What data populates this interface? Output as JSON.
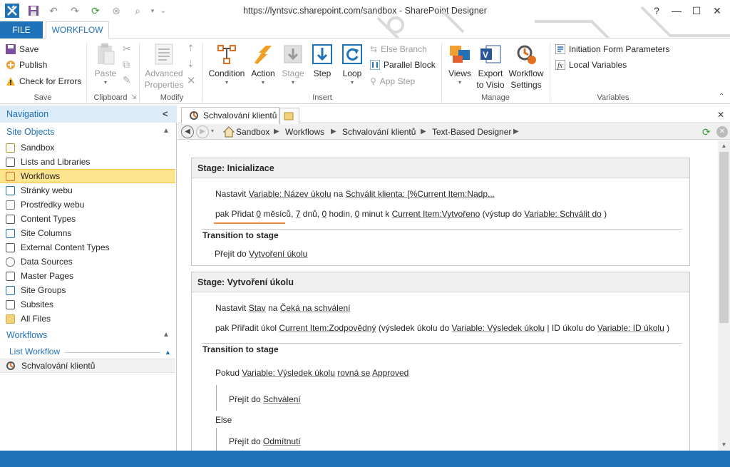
{
  "window": {
    "title": "https://lyntsvc.sharepoint.com/sandbox - SharePoint Designer",
    "help": "?",
    "minimize": "—",
    "maximize": "☐",
    "close": "✕"
  },
  "tabs": {
    "file": "FILE",
    "workflow": "WORKFLOW"
  },
  "ribbon": {
    "save": {
      "save": "Save",
      "publish": "Publish",
      "check": "Check for Errors",
      "label": "Save"
    },
    "clipboard": {
      "paste": "Paste",
      "label": "Clipboard"
    },
    "modify": {
      "adv1": "Advanced",
      "adv2": "Properties",
      "label": "Modify"
    },
    "insert": {
      "condition": "Condition",
      "action": "Action",
      "stage": "Stage",
      "step": "Step",
      "loop": "Loop",
      "else_branch": "Else Branch",
      "parallel_block": "Parallel Block",
      "app_step": "App Step",
      "label": "Insert"
    },
    "manage": {
      "views": "Views",
      "export1": "Export",
      "export2": "to Visio",
      "wfs1": "Workflow",
      "wfs2": "Settings",
      "label": "Manage"
    },
    "variables": {
      "init": "Initiation Form Parameters",
      "local": "Local Variables",
      "label": "Variables"
    }
  },
  "nav": {
    "header": "Navigation",
    "collapse": "<",
    "site_objects": "Site Objects",
    "items": [
      {
        "label": "Sandbox",
        "icon": "home-icon"
      },
      {
        "label": "Lists and Libraries",
        "icon": "list-icon"
      },
      {
        "label": "Workflows",
        "icon": "workflow-icon"
      },
      {
        "label": "Stránky webu",
        "icon": "pages-icon"
      },
      {
        "label": "Prostředky webu",
        "icon": "assets-icon"
      },
      {
        "label": "Content Types",
        "icon": "content-types-icon"
      },
      {
        "label": "Site Columns",
        "icon": "columns-icon"
      },
      {
        "label": "External Content Types",
        "icon": "external-icon"
      },
      {
        "label": "Data Sources",
        "icon": "database-icon"
      },
      {
        "label": "Master Pages",
        "icon": "master-icon"
      },
      {
        "label": "Site Groups",
        "icon": "groups-icon"
      },
      {
        "label": "Subsites",
        "icon": "subsites-icon"
      },
      {
        "label": "All Files",
        "icon": "folder-icon"
      }
    ],
    "workflows_section": "Workflows",
    "list_workflow": "List Workflow",
    "wf_item": "Schvalování klientů",
    "up": "^"
  },
  "doc": {
    "tab": "Schvalování klientů",
    "close": "✕",
    "breadcrumb": [
      "Sandbox",
      "Workflows",
      "Schvalování klientů",
      "Text-Based Designer"
    ]
  },
  "stages": {
    "s1": {
      "title": "Stage: Inicializace",
      "l1": {
        "a": "Nastavit",
        "b": "Variable: Název úkolu",
        "c": "na",
        "d": "Schválit klienta: [%Current Item:Nadp..."
      },
      "l2": {
        "a": "pak Přidat",
        "b": "0",
        "c": "měsíců,",
        "d": "7",
        "e": "dnů,",
        "f": "0",
        "g": "hodin,",
        "h": "0",
        "i": "minut k",
        "j": "Current Item:Vytvořeno",
        "k": "(výstup do",
        "l": "Variable: Schválit do",
        "m": ")"
      },
      "transition": "Transition to stage",
      "goto": {
        "a": "Přejít do",
        "b": "Vytvoření úkolu"
      }
    },
    "s2": {
      "title": "Stage: Vytvoření úkolu",
      "l1": {
        "a": "Nastavit",
        "b": "Stav",
        "c": "na",
        "d": "Čeká na schválení"
      },
      "l2": {
        "a": "pak Přiřadit úkol",
        "b": "Current Item:Zodpovědný",
        "c": "(výsledek úkolu do",
        "d": "Variable: Výsledek úkolu",
        "e": "| ID úkolu do",
        "f": "Variable: ID úkolu",
        "g": ")"
      },
      "transition": "Transition to stage",
      "cond": {
        "a": "Pokud",
        "b": "Variable: Výsledek úkolu",
        "c": "rovná se",
        "d": "Approved"
      },
      "goto1": {
        "a": "Přejít do",
        "b": "Schválení"
      },
      "else": "Else",
      "goto2": {
        "a": "Přejít do",
        "b": "Odmítnutí"
      }
    }
  },
  "colors": {
    "accent": "#2072b8",
    "selection": "#fde48f",
    "orange_icon": "#f0a030"
  }
}
